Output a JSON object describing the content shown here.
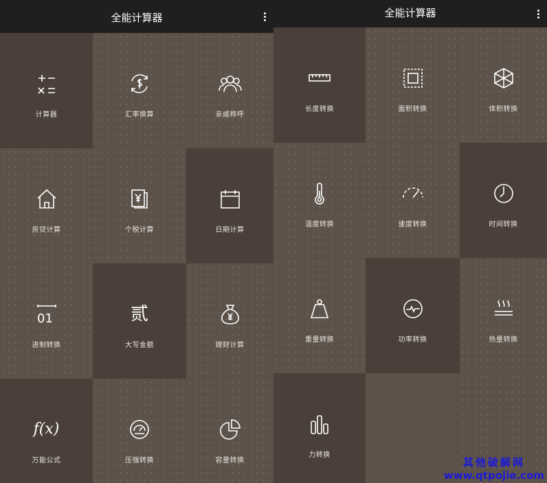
{
  "left": {
    "title": "全能计算器",
    "tiles": [
      {
        "label": "计算器",
        "icon": "calculator-icon"
      },
      {
        "label": "汇率换算",
        "icon": "currency-exchange-icon"
      },
      {
        "label": "亲戚称呼",
        "icon": "relatives-icon"
      },
      {
        "label": "房贷计算",
        "icon": "house-icon"
      },
      {
        "label": "个税计算",
        "icon": "tax-document-icon"
      },
      {
        "label": "日期计算",
        "icon": "calendar-icon"
      },
      {
        "label": "进制转换",
        "icon": "binary-icon",
        "glyph": "01"
      },
      {
        "label": "大写金额",
        "icon": "chinese-numeral-icon",
        "glyph": "贰"
      },
      {
        "label": "理财计算",
        "icon": "money-bag-icon"
      },
      {
        "label": "万能公式",
        "icon": "formula-icon",
        "glyph": "f(x)"
      },
      {
        "label": "压强转换",
        "icon": "pressure-gauge-icon"
      },
      {
        "label": "容量转换",
        "icon": "pie-chart-icon"
      }
    ]
  },
  "right": {
    "title": "全能计算器",
    "tiles": [
      {
        "label": "长度转换",
        "icon": "ruler-icon"
      },
      {
        "label": "面积转换",
        "icon": "area-square-icon"
      },
      {
        "label": "体积转换",
        "icon": "cube-icon"
      },
      {
        "label": "温度转换",
        "icon": "thermometer-icon"
      },
      {
        "label": "速度转换",
        "icon": "speedometer-icon"
      },
      {
        "label": "时间转换",
        "icon": "clock-icon"
      },
      {
        "label": "重量转换",
        "icon": "weight-icon"
      },
      {
        "label": "功率转换",
        "icon": "power-pulse-icon"
      },
      {
        "label": "热量转换",
        "icon": "heat-icon"
      },
      {
        "label": "力转换",
        "icon": "bar-force-icon"
      },
      {
        "label": "",
        "icon": ""
      },
      {
        "label": "",
        "icon": ""
      }
    ]
  },
  "watermark": {
    "line1": "其他破解网",
    "line2": "www.qtpojie.com"
  },
  "colors": {
    "background": "#5d5249",
    "dark_tile": "#4b4039",
    "appbar": "#1f1f1f",
    "watermark": "#1a1ad8"
  }
}
